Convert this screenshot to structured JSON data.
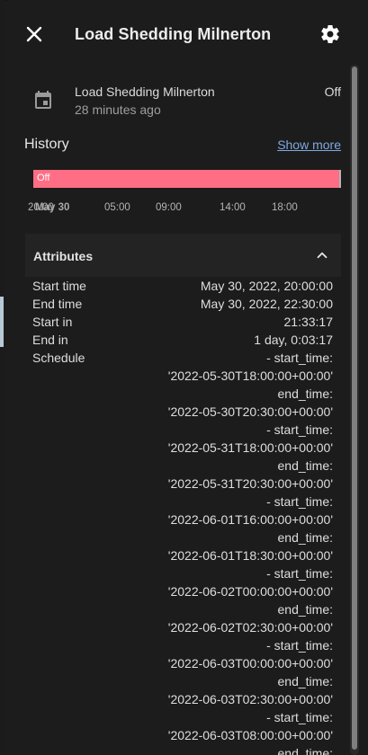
{
  "header": {
    "title": "Load Shedding Milnerton",
    "close_icon": "close-icon",
    "settings_icon": "gear-icon"
  },
  "entity": {
    "name": "Load Shedding Milnerton",
    "last_changed": "28 minutes ago",
    "state": "Off",
    "icon": "calendar-icon"
  },
  "history": {
    "title": "History",
    "show_more": "Show more",
    "timeline_state": "Off",
    "timeline_color": "#ff6e84",
    "ticks": [
      "20:00",
      "May 30",
      "05:00",
      "09:00",
      "14:00",
      "18:00"
    ]
  },
  "attributes": {
    "title": "Attributes",
    "rows": [
      {
        "key": "Start time",
        "value": "May 30, 2022, 20:00:00"
      },
      {
        "key": "End time",
        "value": "May 30, 2022, 22:30:00"
      },
      {
        "key": "Start in",
        "value": "21:33:17"
      },
      {
        "key": "End in",
        "value": "1 day, 0:03:17"
      },
      {
        "key": "Schedule",
        "value": "- start_time:"
      }
    ],
    "schedule_lines": [
      "'2022-05-30T18:00:00+00:00'",
      "end_time:",
      "'2022-05-30T20:30:00+00:00'",
      "- start_time:",
      "'2022-05-31T18:00:00+00:00'",
      "end_time:",
      "'2022-05-31T20:30:00+00:00'",
      "- start_time:",
      "'2022-06-01T16:00:00+00:00'",
      "end_time:",
      "'2022-06-01T18:30:00+00:00'",
      "- start_time:",
      "'2022-06-02T00:00:00+00:00'",
      "end_time:",
      "'2022-06-02T02:30:00+00:00'",
      "- start_time:",
      "'2022-06-03T00:00:00+00:00'",
      "end_time:",
      "'2022-06-03T02:30:00+00:00'",
      "- start_time:",
      "'2022-06-03T08:00:00+00:00'",
      "end_time:"
    ]
  }
}
